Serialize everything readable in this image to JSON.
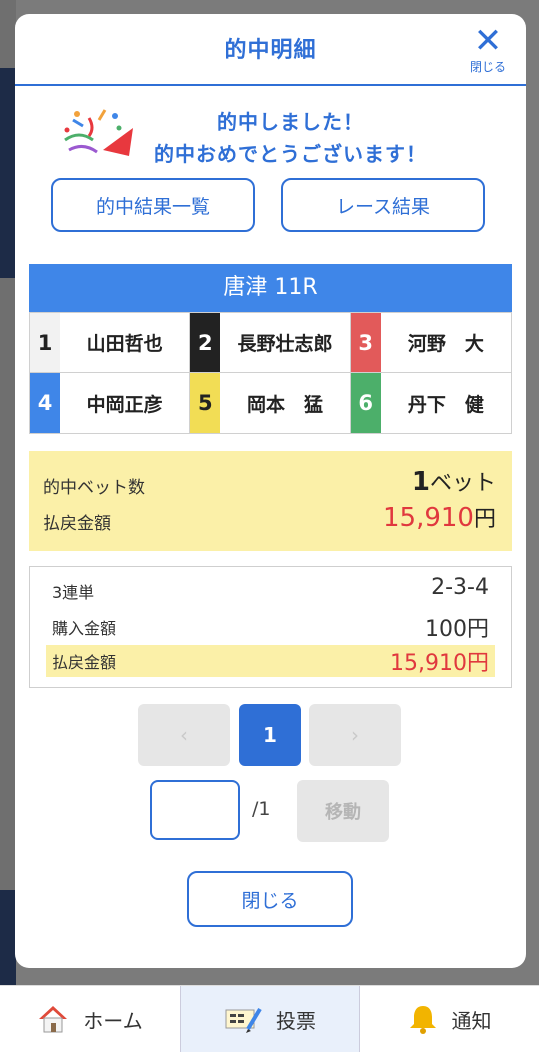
{
  "modal": {
    "title": "的中明細",
    "close_label": "閉じる"
  },
  "congrats": {
    "line1": "的中しました！",
    "line2": "的中おめでとうございます！"
  },
  "buttons": {
    "hit_list": "的中結果一覧",
    "race_result": "レース結果"
  },
  "race": {
    "title": "唐津 11R",
    "racers": [
      {
        "num": "1",
        "name": "山田哲也",
        "bg": "#f2f2f2",
        "fg": "#222222"
      },
      {
        "num": "2",
        "name": "長野壮志郎",
        "bg": "#222222",
        "fg": "#ffffff"
      },
      {
        "num": "3",
        "name": "河野　大",
        "bg": "#e25a5a",
        "fg": "#ffffff"
      },
      {
        "num": "4",
        "name": "中岡正彦",
        "bg": "#3f86e8",
        "fg": "#ffffff"
      },
      {
        "num": "5",
        "name": "岡本　猛",
        "bg": "#f2dd55",
        "fg": "#222222"
      },
      {
        "num": "6",
        "name": "丹下　健",
        "bg": "#4caf6a",
        "fg": "#ffffff"
      }
    ]
  },
  "summary": {
    "bet_count_label": "的中ベット数",
    "bet_count_value": "1",
    "bet_count_unit": "ベット",
    "payout_label": "払戻金額",
    "payout_value": "15,910",
    "payout_unit": "円"
  },
  "detail": {
    "bet_type_label": "3連単",
    "combination": "2-3-4",
    "purchase_label": "購入金額",
    "purchase_value": "100円",
    "payout_label": "払戻金額",
    "payout_value": "15,910円"
  },
  "pager": {
    "prev": "‹",
    "current": "1",
    "next": "›",
    "total": "/1",
    "move_label": "移動"
  },
  "close_button": "閉じる",
  "nav": {
    "home": "ホーム",
    "vote": "投票",
    "notice": "通知"
  },
  "colors": {
    "accent": "#2f6fd6",
    "payout_red": "#e0383e",
    "highlight": "#fbf0a8"
  }
}
